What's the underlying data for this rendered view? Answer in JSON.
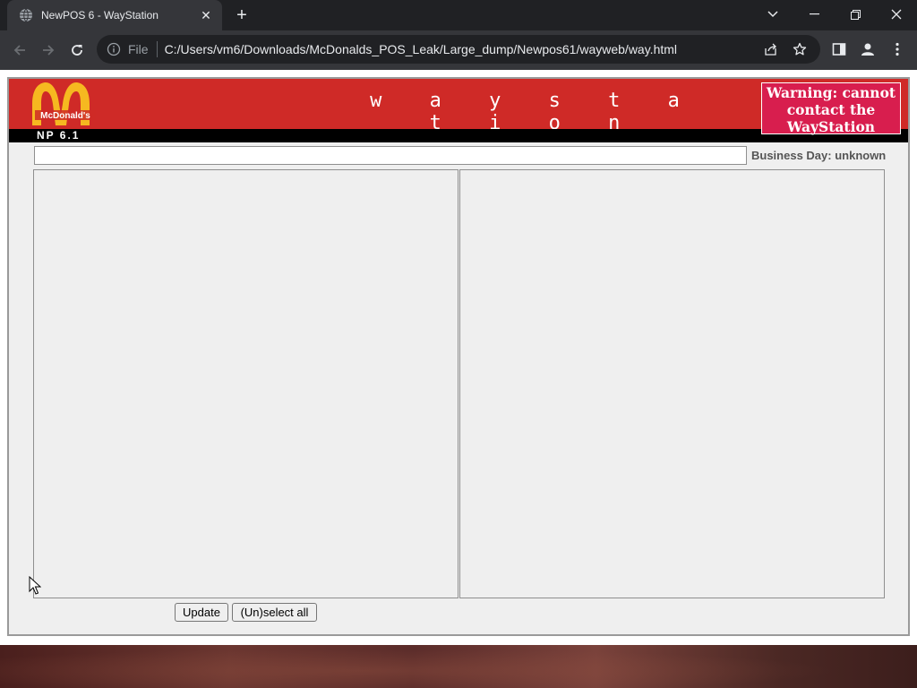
{
  "browser": {
    "tab_title": "NewPOS 6 - WayStation",
    "new_tab_symbol": "+",
    "file_label": "File",
    "url": "C:/Users/vm6/Downloads/McDonalds_POS_Leak/Large_dump/Newpos61/wayweb/way.html"
  },
  "header": {
    "logo_text": "McDonald's",
    "title": "w a y s t a t i o n",
    "warning_text": "Warning: cannot contact the WayStation",
    "version": "NP 6.1"
  },
  "controls": {
    "search_value": "",
    "business_day_label": "Business Day: unknown",
    "update_button": "Update",
    "select_all_button": "(Un)select all"
  },
  "colors": {
    "banner": "#cf2a27",
    "warning": "#d81e4e",
    "logo_arches": "#f6b820"
  }
}
